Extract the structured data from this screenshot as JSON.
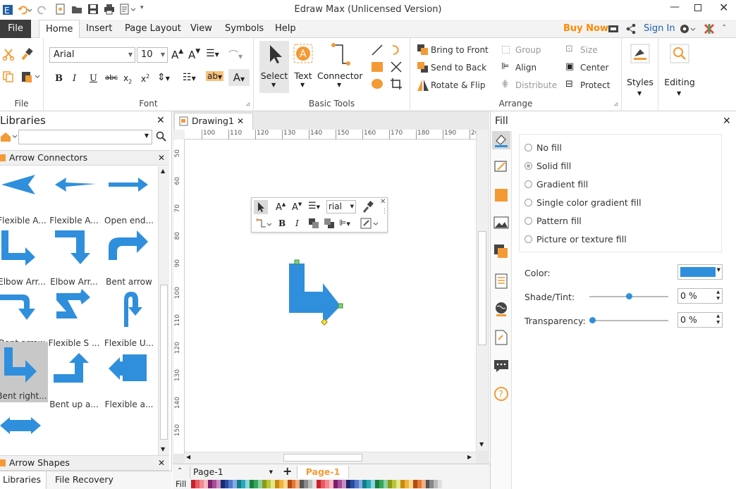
{
  "window": {
    "title": "Edraw Max (Unlicensed Version)"
  },
  "menu": {
    "file": "File",
    "tabs": [
      "Home",
      "Insert",
      "Page Layout",
      "View",
      "Symbols",
      "Help"
    ],
    "buy_now": "Buy Now",
    "sign_in": "Sign In"
  },
  "ribbon": {
    "file_group": "File",
    "font_group": "Font",
    "font_name": "Arial",
    "font_size": "10",
    "basic_tools_group": "Basic Tools",
    "select": "Select",
    "text": "Text",
    "connector": "Connector",
    "arrange_group": "Arrange",
    "bring_to_front": "Bring to Front",
    "send_to_back": "Send to Back",
    "rotate_flip": "Rotate & Flip",
    "group": "Group",
    "align": "Align",
    "distribute": "Distribute",
    "size": "Size",
    "center": "Center",
    "protect": "Protect",
    "styles": "Styles",
    "editing": "Editing"
  },
  "libraries": {
    "title": "Libraries",
    "section": "Arrow Connectors",
    "section2": "Arrow Shapes",
    "shapes": [
      "Flexible A...",
      "Flexible A...",
      "Open end...",
      "Elbow Arr...",
      "Elbow Arr...",
      "Bent arrow",
      "Bent arrow",
      "Flexible S ...",
      "Flexible U...",
      "Bent right...",
      "Bent up a...",
      "Flexible a..."
    ],
    "tab_libraries": "Libraries",
    "tab_recovery": "File Recovery"
  },
  "document": {
    "tab": "Drawing1",
    "page_select": "Page-1",
    "page_tab": "Page-1",
    "fill_label": "Fill",
    "ruler_h": [
      "100",
      "110",
      "120",
      "130",
      "140",
      "150",
      "160",
      "170",
      "180",
      "190",
      "20"
    ],
    "ruler_v": [
      "50",
      "60",
      "70",
      "80",
      "90",
      "100",
      "110",
      "120",
      "130",
      "140",
      "150"
    ],
    "mini_font": "rial"
  },
  "fill": {
    "title": "Fill",
    "options": [
      "No fill",
      "Solid fill",
      "Gradient fill",
      "Single color gradient fill",
      "Pattern fill",
      "Picture or texture fill"
    ],
    "selected": 1,
    "color_label": "Color:",
    "shade_label": "Shade/Tint:",
    "shade_value": "0 %",
    "transparency_label": "Transparency:",
    "transparency_value": "0 %",
    "color": "#2f8fdc"
  },
  "colors": {
    "accent": "#2f8fdc",
    "orange": "#f39a35",
    "ribbon_accent": "#ff8a00"
  }
}
